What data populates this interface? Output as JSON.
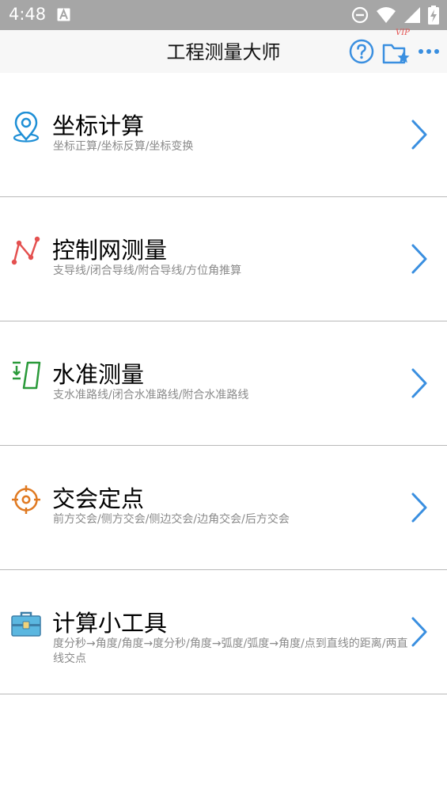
{
  "status": {
    "time": "4:48"
  },
  "appbar": {
    "title": "工程测量大师",
    "vip_label": "VIP"
  },
  "items": [
    {
      "title": "坐标计算",
      "subtitle": "坐标正算/坐标反算/坐标变换"
    },
    {
      "title": "控制网测量",
      "subtitle": "支导线/闭合导线/附合导线/方位角推算"
    },
    {
      "title": "水准测量",
      "subtitle": "支水准路线/闭合水准路线/附合水准路线"
    },
    {
      "title": "交会定点",
      "subtitle": "前方交会/侧方交会/侧边交会/边角交会/后方交会"
    },
    {
      "title": "计算小工具",
      "subtitle": "度分秒→角度/角度→度分秒/角度→弧度/弧度→角度/点到直线的距离/两直线交点"
    }
  ],
  "colors": {
    "accent": "#3a8fe0",
    "location_icon": "#1e8fd6",
    "network_icon": "#e4504f",
    "level_icon": "#2a9a3a",
    "target_icon": "#e07a22",
    "toolbox_icon": "#5bb7e0"
  }
}
